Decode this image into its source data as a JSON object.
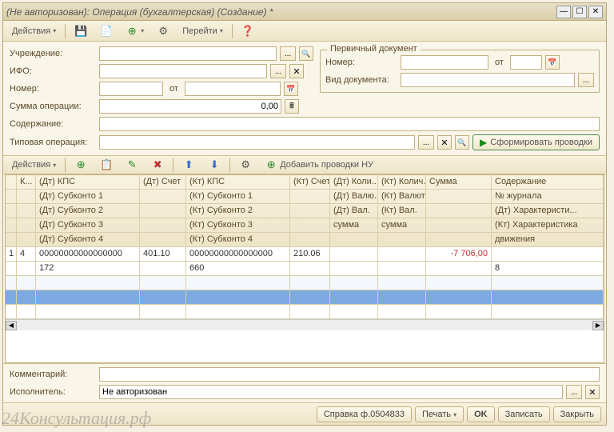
{
  "window": {
    "title": "(Не авторизован): Операция (бухгалтерская) (Создание) *"
  },
  "main_toolbar": {
    "actions": "Действия",
    "goto": "Перейти"
  },
  "form": {
    "org_label": "Учреждение:",
    "org_value": "",
    "ifo_label": "ИФО:",
    "number_label": "Номер:",
    "from_label": "от",
    "sum_label": "Сумма операции:",
    "sum_value": "0,00",
    "content_label": "Содержание:",
    "typical_label": "Типовая операция:",
    "form_postings": "Сформировать проводки"
  },
  "primary_doc": {
    "legend": "Первичный документ",
    "number_label": "Номер:",
    "from_label": "от",
    "type_label": "Вид документа:"
  },
  "grid_toolbar": {
    "actions": "Действия",
    "add_nu": "Добавить проводки НУ"
  },
  "grid_headers": {
    "r1": {
      "c1": "К...",
      "c2": "(Дт) КПС",
      "c3": "(Дт) Счет",
      "c4": "(Кт) КПС",
      "c5": "(Кт) Счет",
      "c6": "(Дт) Коли...",
      "c7": "(Кт) Колич...",
      "c8": "Сумма",
      "c9": "Содержание"
    },
    "r2": {
      "c2": "(Дт) Субконто 1",
      "c4": "(Кт) Субконто 1",
      "c6": "(Дт) Валю...",
      "c7": "(Кт) Валюта",
      "c9": "№ журнала"
    },
    "r3": {
      "c2": "(Дт) Субконто 2",
      "c4": "(Кт) Субконто 2",
      "c6": "(Дт) Вал.",
      "c7": "(Кт) Вал.",
      "c9": "(Дт) Характеристи..."
    },
    "r4": {
      "c2": "(Дт) Субконто 3",
      "c4": "(Кт) Субконто 3",
      "c6": "сумма",
      "c7": "сумма",
      "c9": "(Кт) Характеристика"
    },
    "r5": {
      "c2": "(Дт) Субконто 4",
      "c4": "(Кт) Субконто 4",
      "c9": "движения"
    }
  },
  "grid_data": {
    "row1": {
      "n": "1",
      "k": "4",
      "dt_kps": "00000000000000000",
      "dt_acc": "401.10",
      "kt_kps": "00000000000000000",
      "kt_acc": "210.06",
      "sum": "-7 706,00"
    },
    "row2": {
      "dt_sub1": "172",
      "kt_sub1": "660",
      "journal": "8"
    }
  },
  "bottom": {
    "comment_label": "Комментарий:",
    "executor_label": "Исполнитель:",
    "executor_value": "Не авторизован"
  },
  "footer": {
    "ref": "Справка ф.0504833",
    "print": "Печать",
    "ok": "OK",
    "save": "Записать",
    "close": "Закрыть"
  },
  "watermark": "24Консультация.рф"
}
